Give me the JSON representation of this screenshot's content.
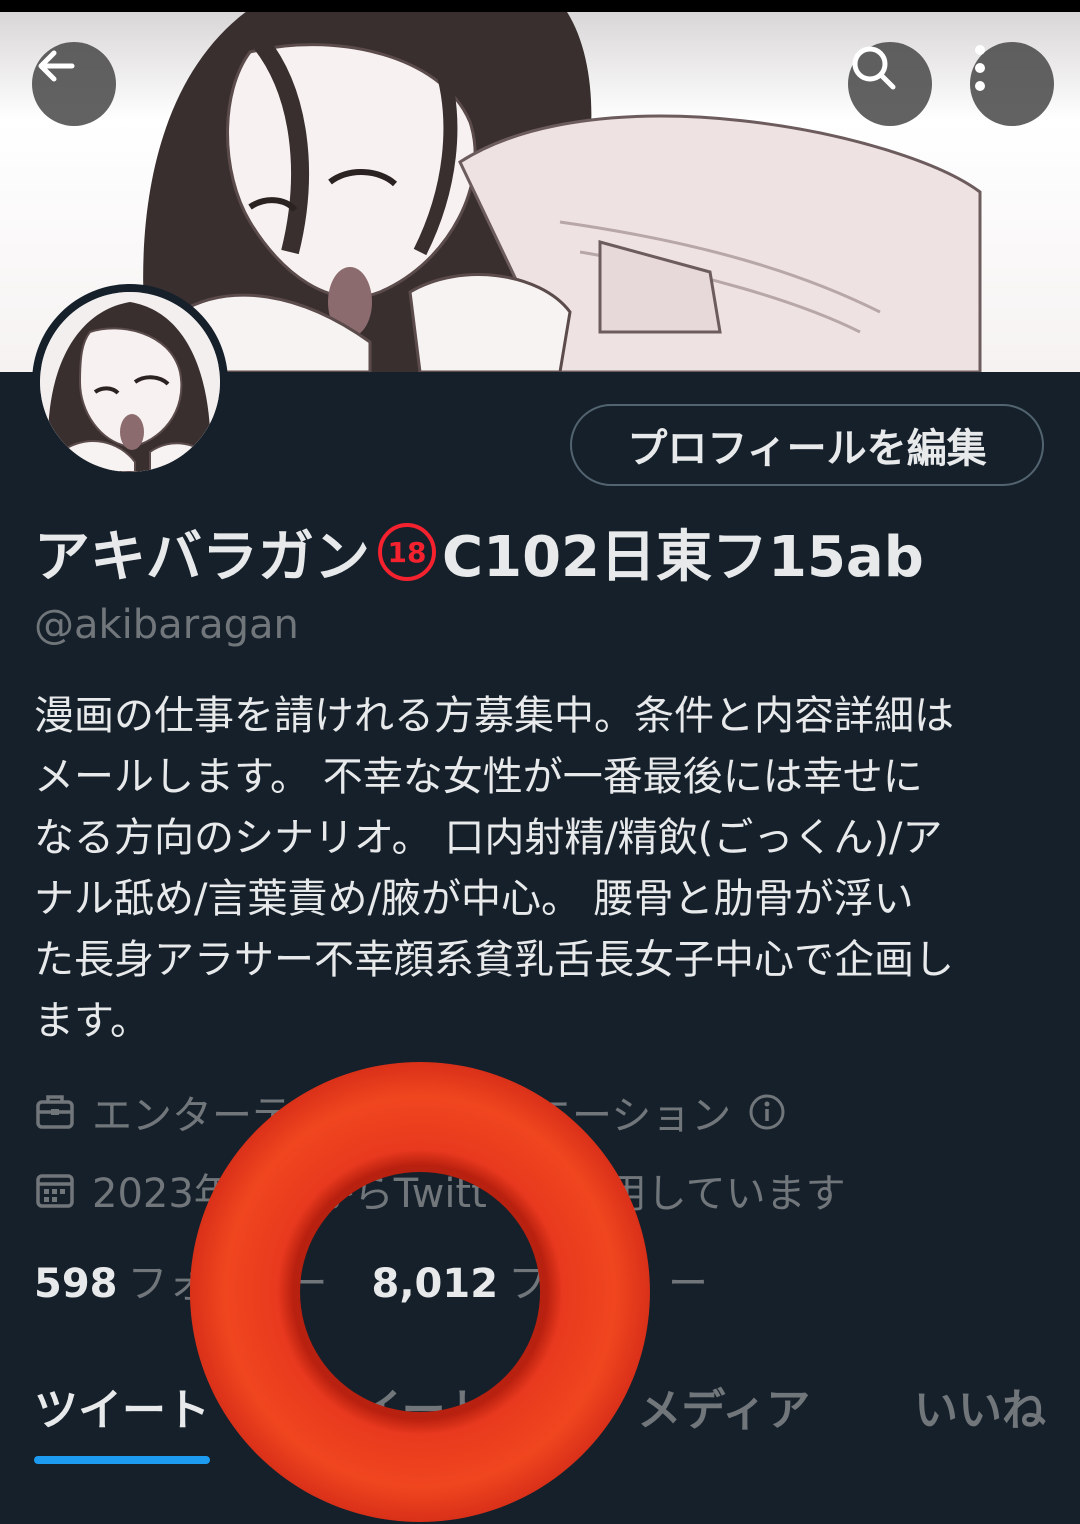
{
  "profile": {
    "edit_button": "プロフィールを編集",
    "name_before": "アキバラガン",
    "age_badge": "18",
    "name_after": "C102日東フ15ab",
    "handle": "@akibaragan",
    "bio": [
      "漫画の仕事を請けれる方募集中。条件と内容詳細は",
      "メールします。 不幸な女性が一番最後には幸せに",
      "なる方向のシナリオ。 口内射精/精飲(ごっくん)/ア",
      "ナル舐め/言葉責め/腋が中心。 腰骨と肋骨が浮い",
      "た長身アラサー不幸顔系貧乳舌長女子中心で企画し",
      "ます。"
    ],
    "category": "エンターテ　　　　クリエーション",
    "joined": "2023年　　からTwitt　　利用しています",
    "following_count": "598",
    "following_label": "フォ　　ー",
    "followers_count": "8,012",
    "followers_label": "フォ　　ー"
  },
  "tabs": [
    {
      "label": "ツイート",
      "active": true
    },
    {
      "label": "　イートと",
      "active": false
    },
    {
      "label": "メディア",
      "active": false
    },
    {
      "label": "いいね",
      "active": false
    }
  ],
  "icons": {
    "back": "arrow-left-icon",
    "search": "search-icon",
    "more": "more-vertical-icon",
    "category": "briefcase-icon",
    "info": "info-icon",
    "joined": "calendar-icon"
  },
  "colors": {
    "background": "#15202b",
    "accent": "#1d9bf0",
    "badge": "#f4212e",
    "overlay_ring": "#e8391e"
  }
}
